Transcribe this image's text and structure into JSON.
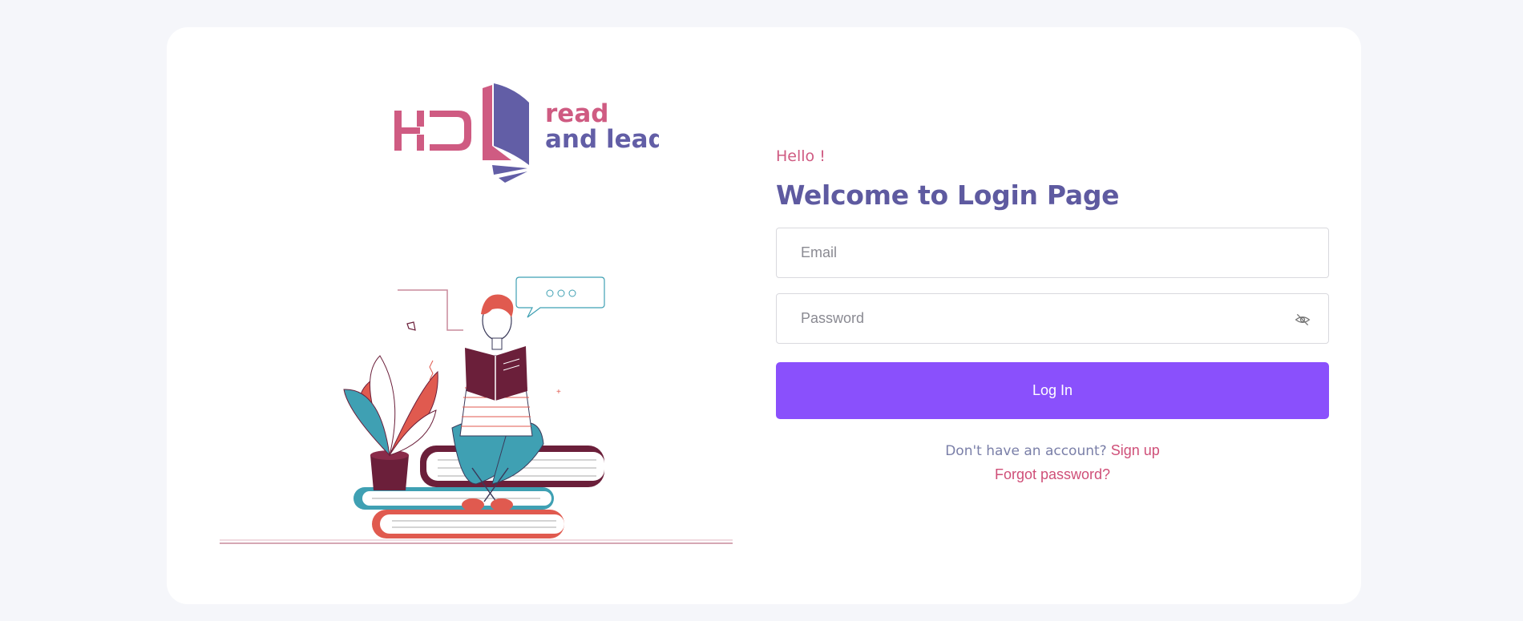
{
  "brand": {
    "logo_text_line1": "read",
    "logo_text_line2": "and lead",
    "logo_mark": "HD",
    "colors": {
      "pink": "#cf5b82",
      "purple": "#5e5aa0"
    }
  },
  "login": {
    "greeting": "Hello !",
    "title": "Welcome to Login Page",
    "email_placeholder": "Email",
    "password_placeholder": "Password",
    "login_button": "Log In",
    "signup_prompt": "Don't have an account?",
    "signup_link": "Sign up",
    "forgot_link": "Forgot password?",
    "button_color": "#8a50fc"
  },
  "icons": {
    "password_toggle": "eye-off-icon"
  }
}
